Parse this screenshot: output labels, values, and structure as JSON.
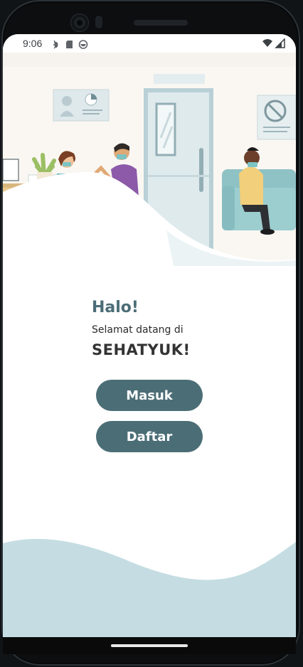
{
  "status_bar": {
    "time": "9:06",
    "left_icons": [
      "bug-icon",
      "sd-card-icon",
      "privacy-icon"
    ],
    "right_icons": [
      "wifi-icon",
      "signal-icon"
    ]
  },
  "welcome": {
    "greeting": "Halo!",
    "subtitle": "Selamat datang di",
    "app_name": "SEHATYUK!"
  },
  "buttons": {
    "login_label": "Masuk",
    "register_label": "Daftar"
  },
  "colors": {
    "accent": "#4b6e76",
    "greeting_color": "#4c6d77",
    "wave": "#c5dde2"
  }
}
